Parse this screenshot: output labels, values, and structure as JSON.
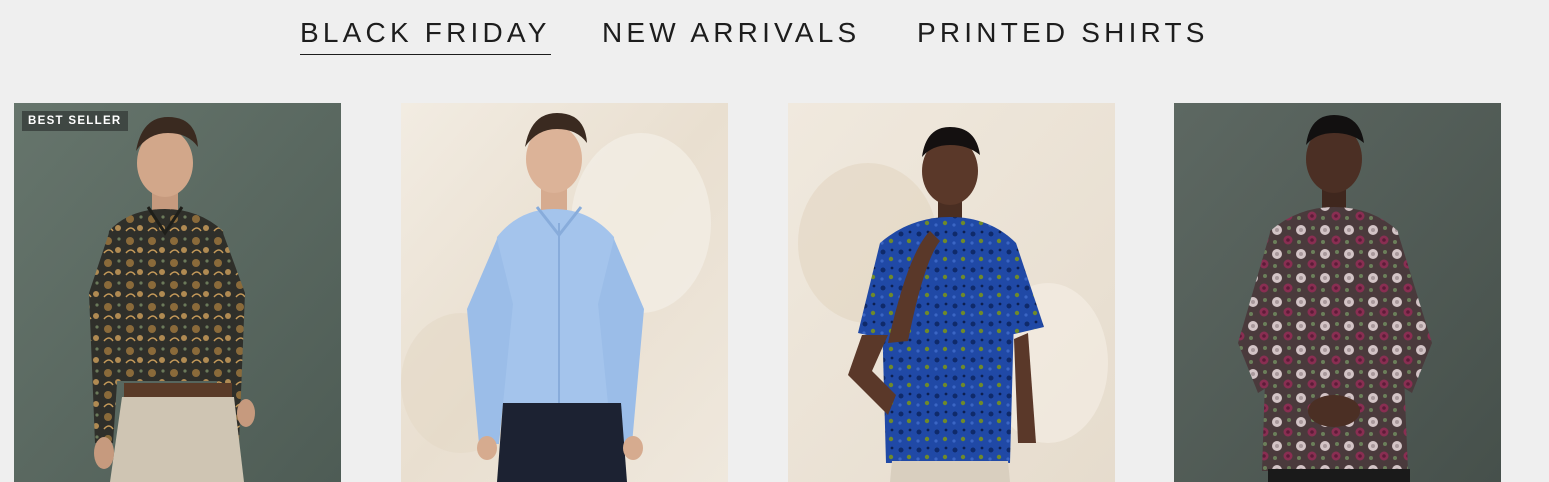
{
  "tabs": [
    {
      "label": "BLACK FRIDAY",
      "active": true
    },
    {
      "label": "NEW ARRIVALS",
      "active": false
    },
    {
      "label": "PRINTED SHIRTS",
      "active": false
    }
  ],
  "products": [
    {
      "badge": "BEST SELLER",
      "background": "#5b6a62",
      "shirt_color": "#3a3528",
      "shirt_print": "paisley",
      "trousers_color": "#cfc5b3"
    },
    {
      "badge": "",
      "background": "#ece5da",
      "shirt_color": "#9fc0ea",
      "shirt_print": "solid",
      "trousers_color": "#1c2232"
    },
    {
      "badge": "",
      "background": "#ece4d8",
      "shirt_color": "#1f49a8",
      "shirt_print": "floral",
      "trousers_color": "#d9cfbf"
    },
    {
      "badge": "",
      "background": "#515c56",
      "shirt_color": "#5e4a4d",
      "shirt_print": "floral",
      "trousers_color": "#1a1a1a"
    }
  ]
}
